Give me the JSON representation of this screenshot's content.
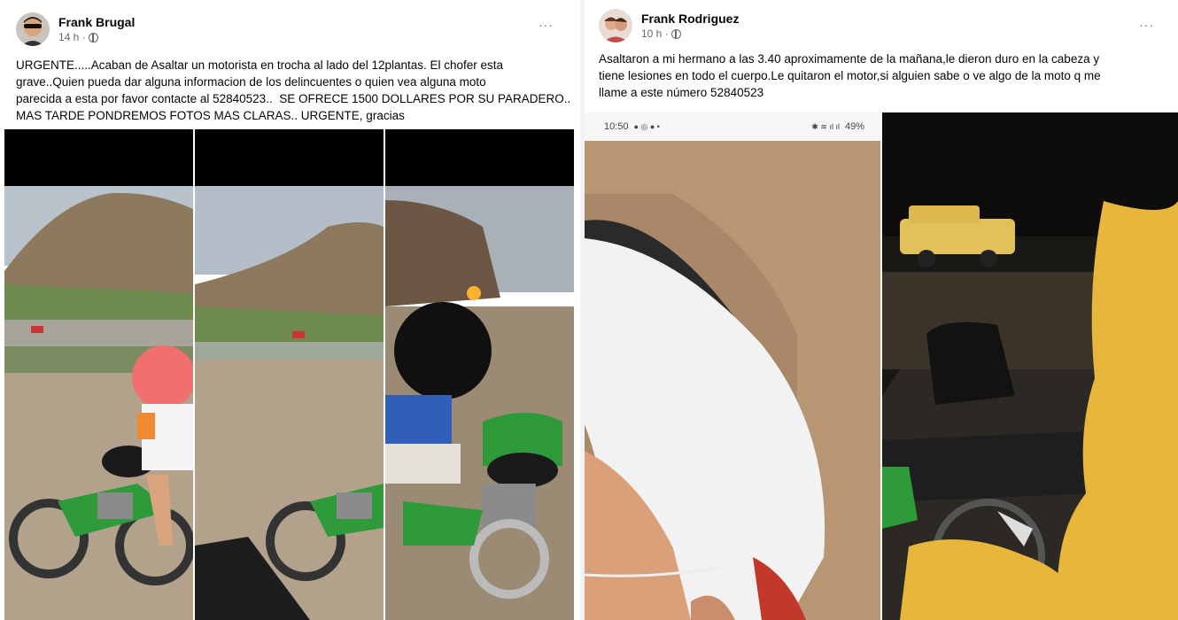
{
  "post_left": {
    "author": "Frank Brugal",
    "time": "14 h ·",
    "more": "···",
    "text": "URGENTE.....Acaban de Asaltar un motorista en trocha al lado del 12plantas. El chofer esta\ngrave..Quien pueda dar alguna informacion de los delincuentes o quien vea alguna moto\nparecida a esta por favor contacte al 52840523..  SE OFRECE 1500 DOLLARES POR SU PARADERO..\nMAS TARDE PONDREMOS FOTOS MAS CLARAS.. URGENTE, gracias",
    "photos": [
      "motorcycle-photo-1",
      "motorcycle-photo-2",
      "motorcycle-photo-3"
    ]
  },
  "post_right": {
    "author": "Frank Rodriguez",
    "time": "10 h ·",
    "more": "···",
    "text": "Asaltaron a mi hermano a las 3.40 aproximamente de la mañana,le dieron duro en la cabeza y\ntiene lesiones en todo el cuerpo.Le quitaron el motor,si alguien sabe o ve algo de la moto q me\nllame a este número 52840523",
    "phone_status": {
      "time": "10:50",
      "battery": "49%"
    },
    "photos": [
      "injury-photo",
      "night-motorcycle-photo"
    ]
  },
  "colors": {
    "motorcycle_green": "#2e9a3a",
    "blur_orange": "#e8b63a",
    "blur_red": "#f07070"
  }
}
